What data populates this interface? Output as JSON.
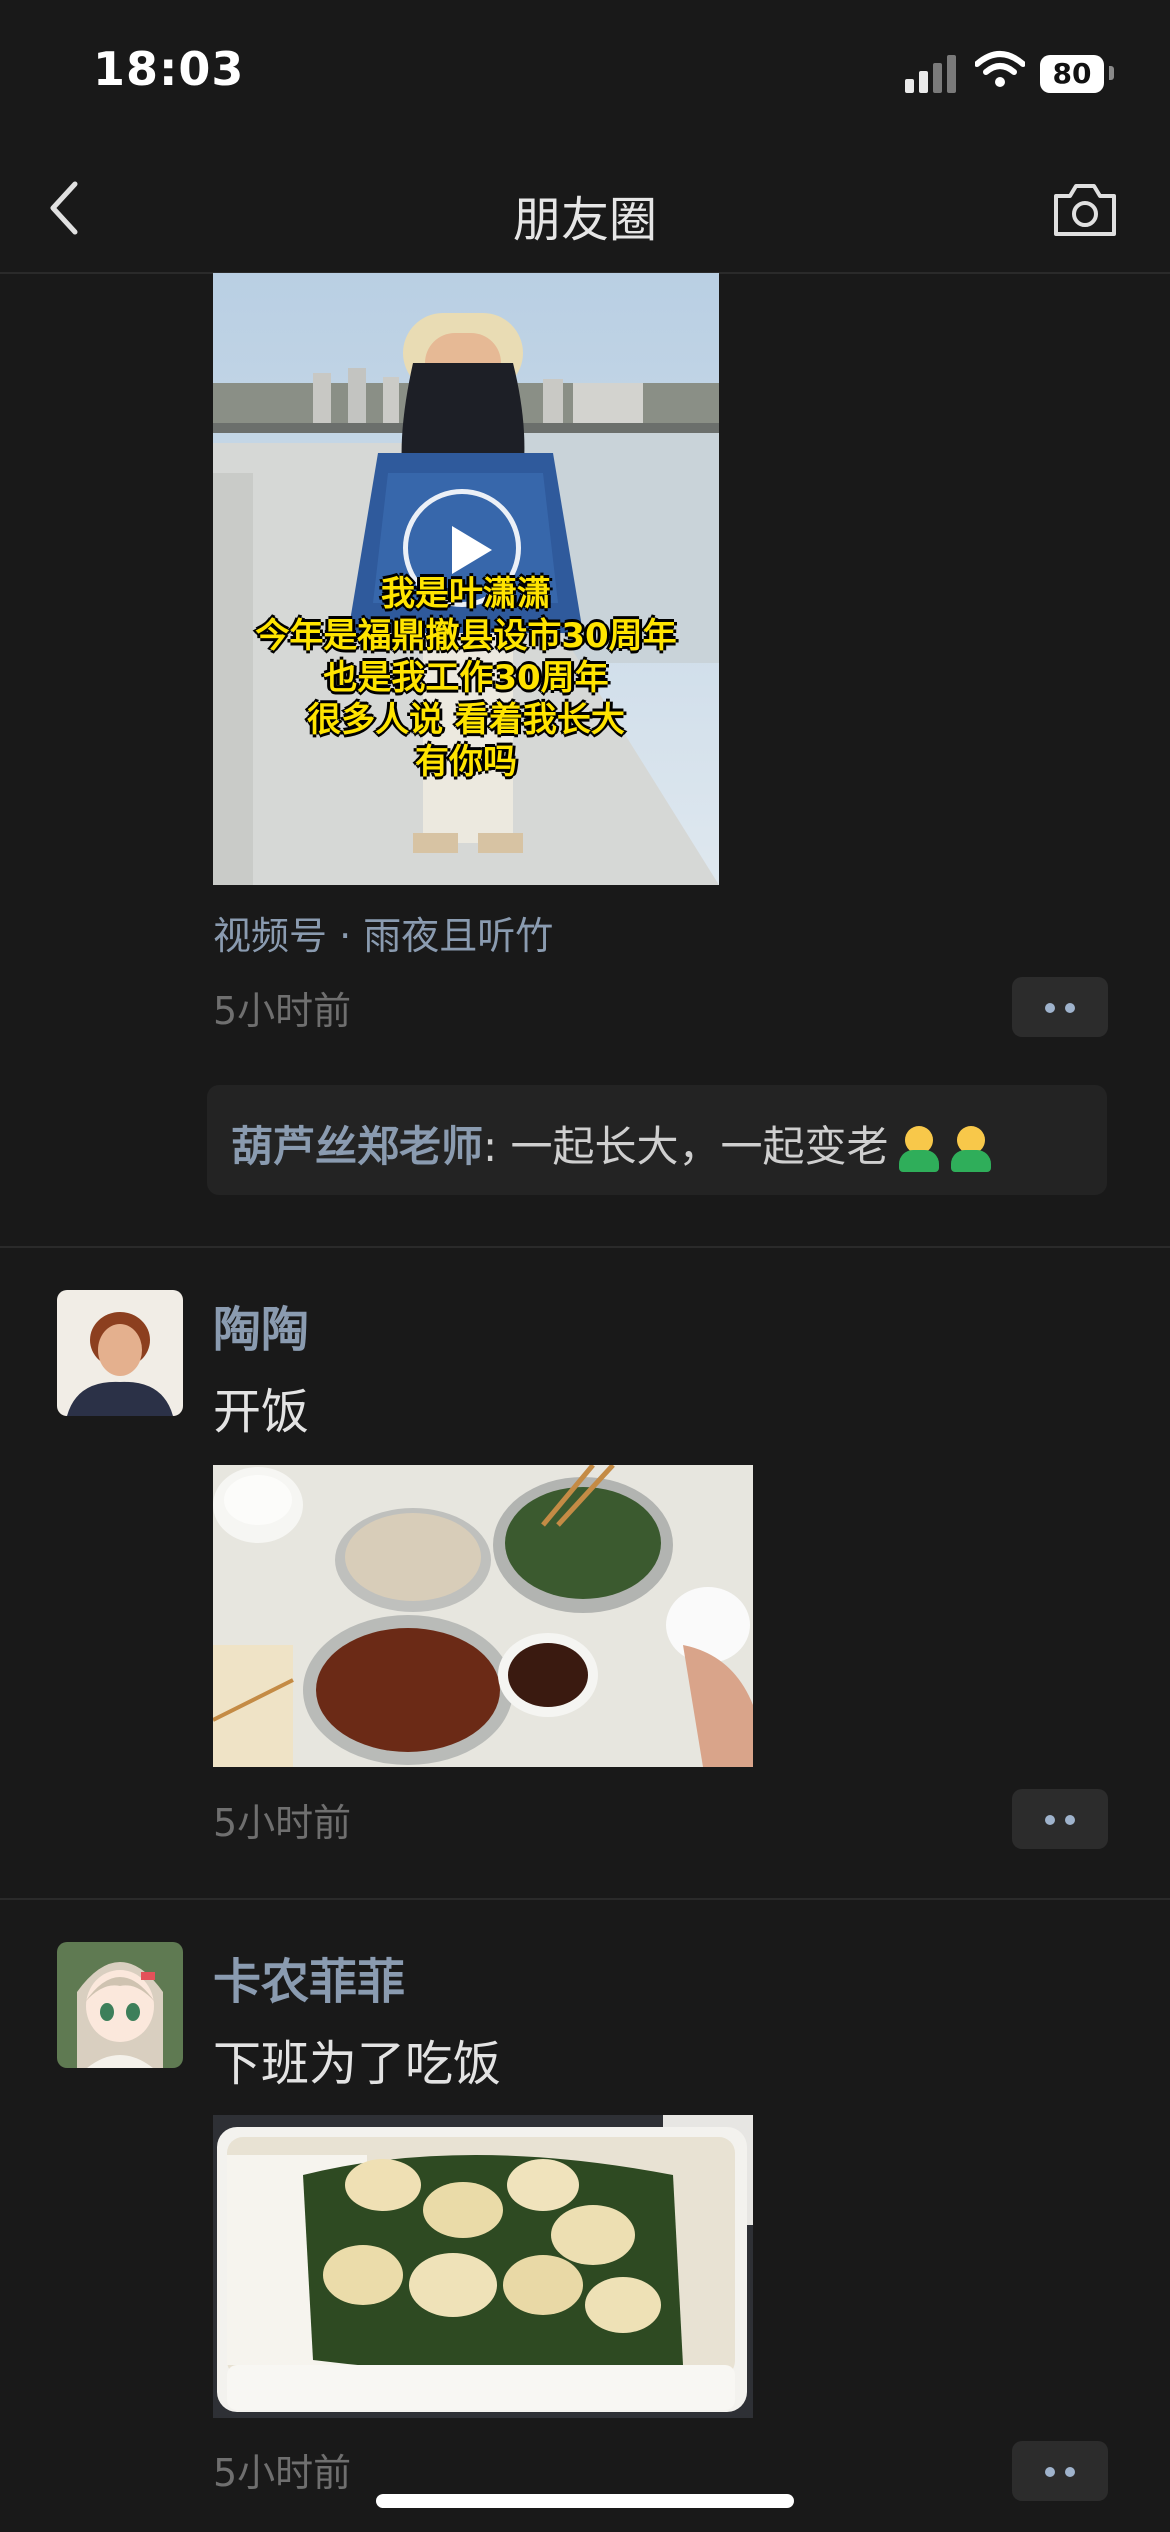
{
  "status_bar": {
    "time": "18:03",
    "battery": "80"
  },
  "nav": {
    "title": "朋友圈"
  },
  "posts": [
    {
      "video_caption": [
        "我是叶潇潇",
        "今年是福鼎撤县设市30周年",
        "也是我工作30周年",
        "很多人说  看着我长大",
        "有你吗"
      ],
      "source": "视频号 · 雨夜且听竹",
      "time": "5小时前",
      "comment": {
        "author": "葫芦丝郑老师",
        "text": ": 一起长大，一起变老"
      }
    },
    {
      "name": "陶陶",
      "text": "开饭",
      "time": "5小时前"
    },
    {
      "name": "卡农菲菲",
      "text": "下班为了吃饭",
      "time": "5小时前"
    }
  ]
}
